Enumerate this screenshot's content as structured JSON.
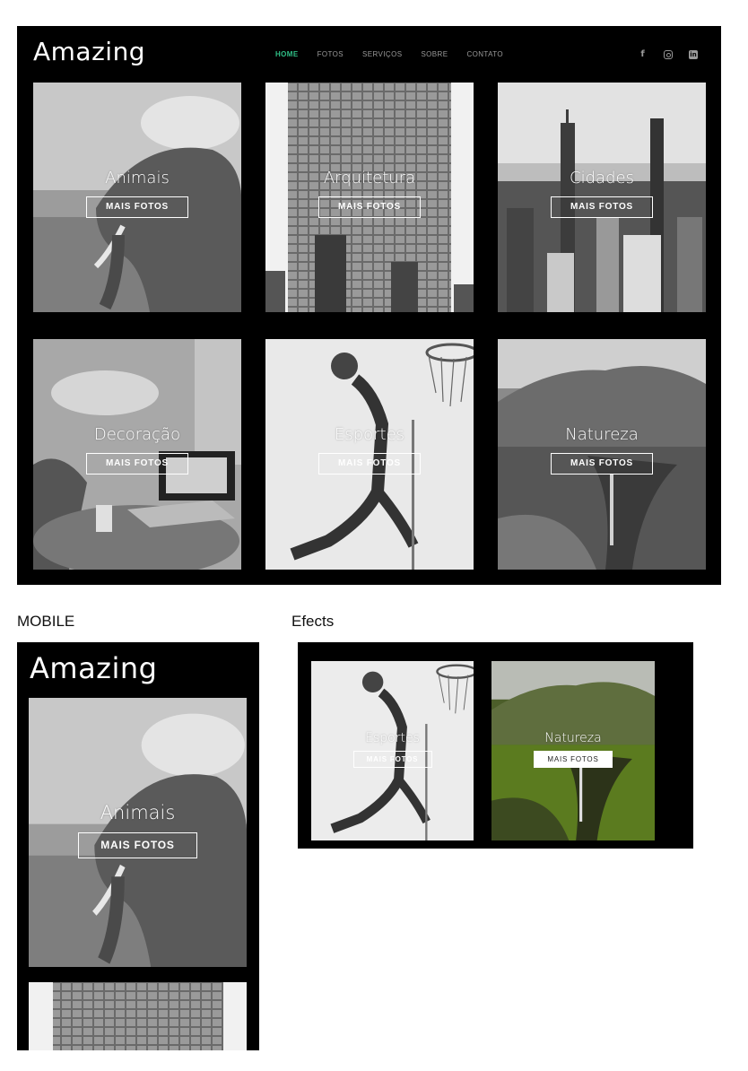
{
  "desktop": {
    "logo": "Amazing",
    "nav": [
      {
        "label": "HOME",
        "active": true
      },
      {
        "label": "FOTOS",
        "active": false
      },
      {
        "label": "SERVIÇOS",
        "active": false
      },
      {
        "label": "SOBRE",
        "active": false
      },
      {
        "label": "CONTATO",
        "active": false
      }
    ],
    "social_icons": [
      "facebook-icon",
      "instagram-icon",
      "linkedin-icon"
    ],
    "accent_color": "#2fbf86",
    "cards": [
      {
        "title": "Animais",
        "button": "MAIS FOTOS"
      },
      {
        "title": "Arquitetura",
        "button": "MAIS FOTOS"
      },
      {
        "title": "Cidades",
        "button": "MAIS FOTOS"
      },
      {
        "title": "Decoração",
        "button": "MAIS FOTOS"
      },
      {
        "title": "Esportes",
        "button": "MAIS FOTOS"
      },
      {
        "title": "Natureza",
        "button": "MAIS FOTOS"
      }
    ]
  },
  "mobile": {
    "section_label": "MOBILE",
    "logo": "Amazing",
    "cards": [
      {
        "title": "Animais",
        "button": "MAIS FOTOS"
      }
    ]
  },
  "effects": {
    "section_label": "Efects",
    "cards": [
      {
        "title": "Esportes",
        "button": "MAIS FOTOS"
      },
      {
        "title": "Natureza",
        "button": "MAIS FOTOS"
      }
    ]
  }
}
